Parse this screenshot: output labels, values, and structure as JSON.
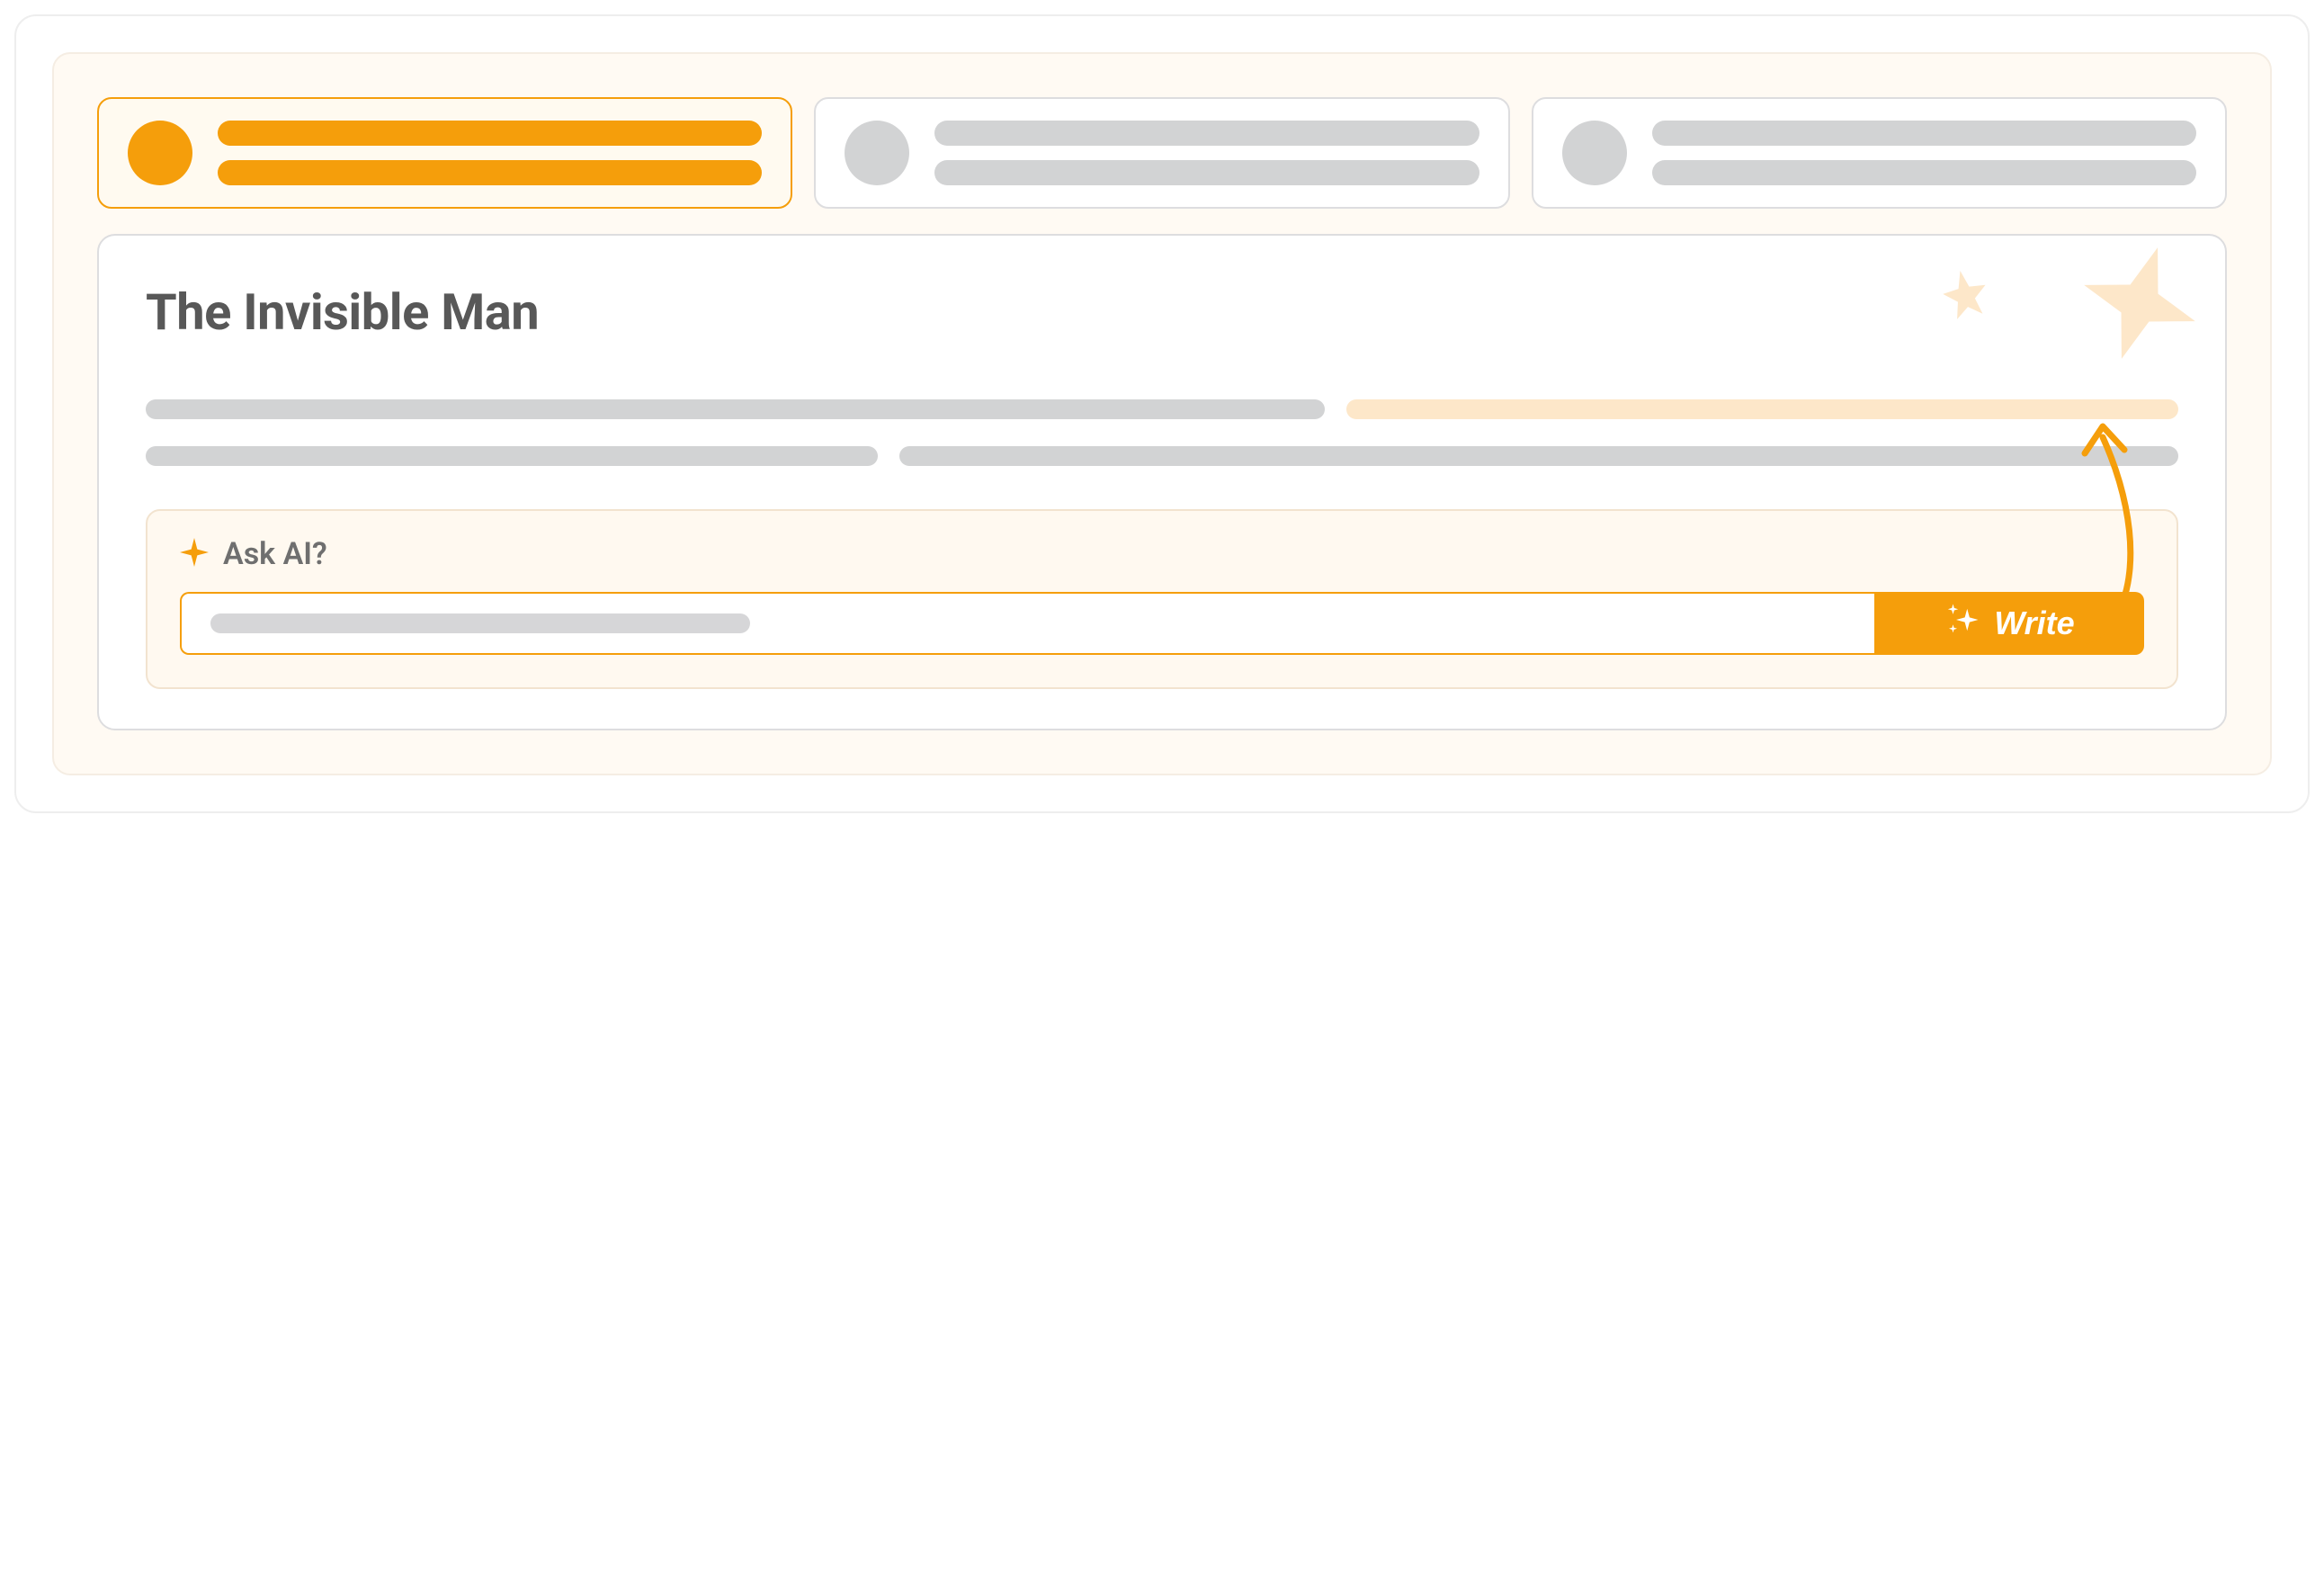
{
  "colors": {
    "accent": "#f59e0b",
    "accent_light": "#fde7c9",
    "skeleton": "#d2d3d4",
    "text_muted": "#585858"
  },
  "tabs": [
    {
      "active": true
    },
    {
      "active": false
    },
    {
      "active": false
    }
  ],
  "content": {
    "title": "The Invisible Man"
  },
  "ask_ai": {
    "label": "Ask AI?",
    "button_label": "Write",
    "icon": "sparkle-icon"
  }
}
